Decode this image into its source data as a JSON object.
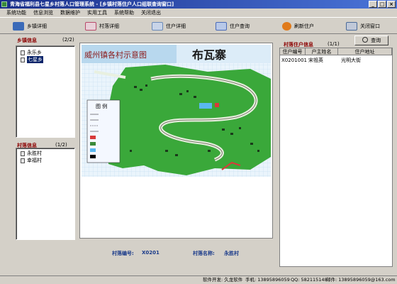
{
  "window": {
    "title": "青海省福利县七星乡村落人口管理系统 - [乡镇村落住户人口组联查询窗口]"
  },
  "menu": [
    "系统功能",
    "信息浏览",
    "数据维护",
    "实用工具",
    "系统帮助",
    "关闭退出"
  ],
  "toolbar": [
    {
      "label": "乡镇详细",
      "icon": "blue-cube-icon",
      "color": "#3a6ab8"
    },
    {
      "label": "村落详细",
      "icon": "card-icon",
      "color": "#b84a6a"
    },
    {
      "label": "住户详细",
      "icon": "keyboard-icon",
      "color": "#6a8ab8"
    },
    {
      "label": "住户查询",
      "icon": "find-icon",
      "color": "#4a6ab8"
    },
    {
      "label": "刷新住户",
      "icon": "refresh-icon",
      "color": "#e07a1a"
    },
    {
      "label": "关闭窗口",
      "icon": "close-window-icon",
      "color": "#4a6a98"
    }
  ],
  "towns": {
    "label": "乡镇信息",
    "count": "(2/2)",
    "items": [
      "永乐乡",
      "七星乡"
    ],
    "selected": 1
  },
  "villages": {
    "label": "村落信息",
    "count": "(1/2)",
    "items": [
      "永胜村",
      "幸福村"
    ]
  },
  "map": {
    "title": "威州镇各村示意图",
    "village_name": "布瓦寨",
    "legend_title": "图 例"
  },
  "residents": {
    "label": "村落住户信息",
    "count": "(1/1)",
    "query_button": "查询",
    "columns": [
      "住户编号",
      "户主姓名",
      "住户地址"
    ],
    "rows": [
      [
        "X0201001",
        "宋祖英",
        "光明大街"
      ]
    ]
  },
  "info": {
    "village_code_label": "村落编号:",
    "village_code": "X0201",
    "village_name_label": "村落名称:",
    "village_name": "永胜村"
  },
  "status": {
    "developer": "软件开发: 久龙软件",
    "phone": "手机: 13895896059",
    "qq": "QQ: 582115148",
    "email": "邮件: 13895896059@163.com"
  },
  "colors": {
    "map_green": "#3aa83a",
    "map_grid": "#e8f4ff",
    "title_bar": "#1a2f8a",
    "panel_label": "#8b0000"
  }
}
